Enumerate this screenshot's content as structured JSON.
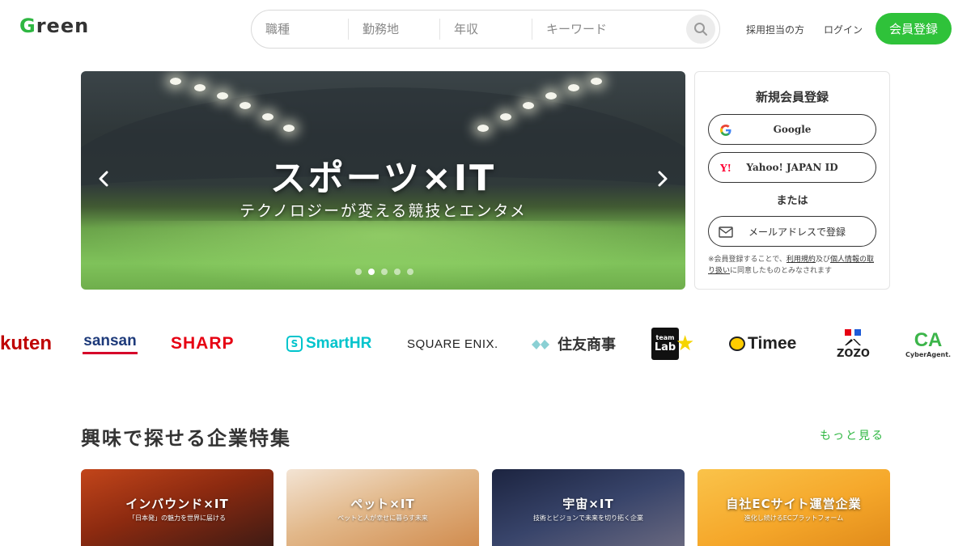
{
  "header": {
    "logo": "Green",
    "search": {
      "job_type_placeholder": "職種",
      "location_placeholder": "勤務地",
      "salary_placeholder": "年収",
      "keyword_placeholder": "キーワード"
    },
    "recruiter_link": "採用担当の方",
    "login_link": "ログイン",
    "signup_button": "会員登録"
  },
  "hero": {
    "title": "スポーツ×IT",
    "subtitle": "テクノロジーが変える競技とエンタメ",
    "slide_count": 5,
    "active_slide": 2
  },
  "register": {
    "title": "新規会員登録",
    "google_label": "Google",
    "yahoo_label": "Yahoo! JAPAN ID",
    "or_label": "または",
    "email_label": "メールアドレスで登録",
    "note_prefix": "※会員登録することで、",
    "terms_link": "利用規約",
    "note_and": "及び",
    "privacy_link": "個人情報の取り扱い",
    "note_suffix": "に同意したものとみなされます"
  },
  "logos": {
    "rakuten": "kuten",
    "sansan": "sansan",
    "sharp": "SHARP",
    "smarthr": "SmartHR",
    "squareenix": "SQUARE ENIX.",
    "sumitomo": "住友商事",
    "teamlab_top": "team",
    "teamlab_bottom": "Lab",
    "timee": "Timee",
    "zozo": "ZOZO",
    "cyberagent_mark": "CA",
    "cyberagent": "CyberAgent."
  },
  "feature_section": {
    "title": "興味で探せる企業特集",
    "more_link": "もっと見る",
    "cards": [
      {
        "title": "インバウンド×IT",
        "subtitle": "「日本発」の魅力を世界に届ける"
      },
      {
        "title": "ペット×IT",
        "subtitle": "ペットと人が幸せに暮らす未来"
      },
      {
        "title": "宇宙×IT",
        "subtitle": "技術とビジョンで未来を切り拓く企業"
      },
      {
        "title": "自社ECサイト運営企業",
        "subtitle": "進化し続けるECプラットフォーム"
      }
    ]
  },
  "colors": {
    "brand_green": "#2fc23a",
    "text": "#333333"
  }
}
